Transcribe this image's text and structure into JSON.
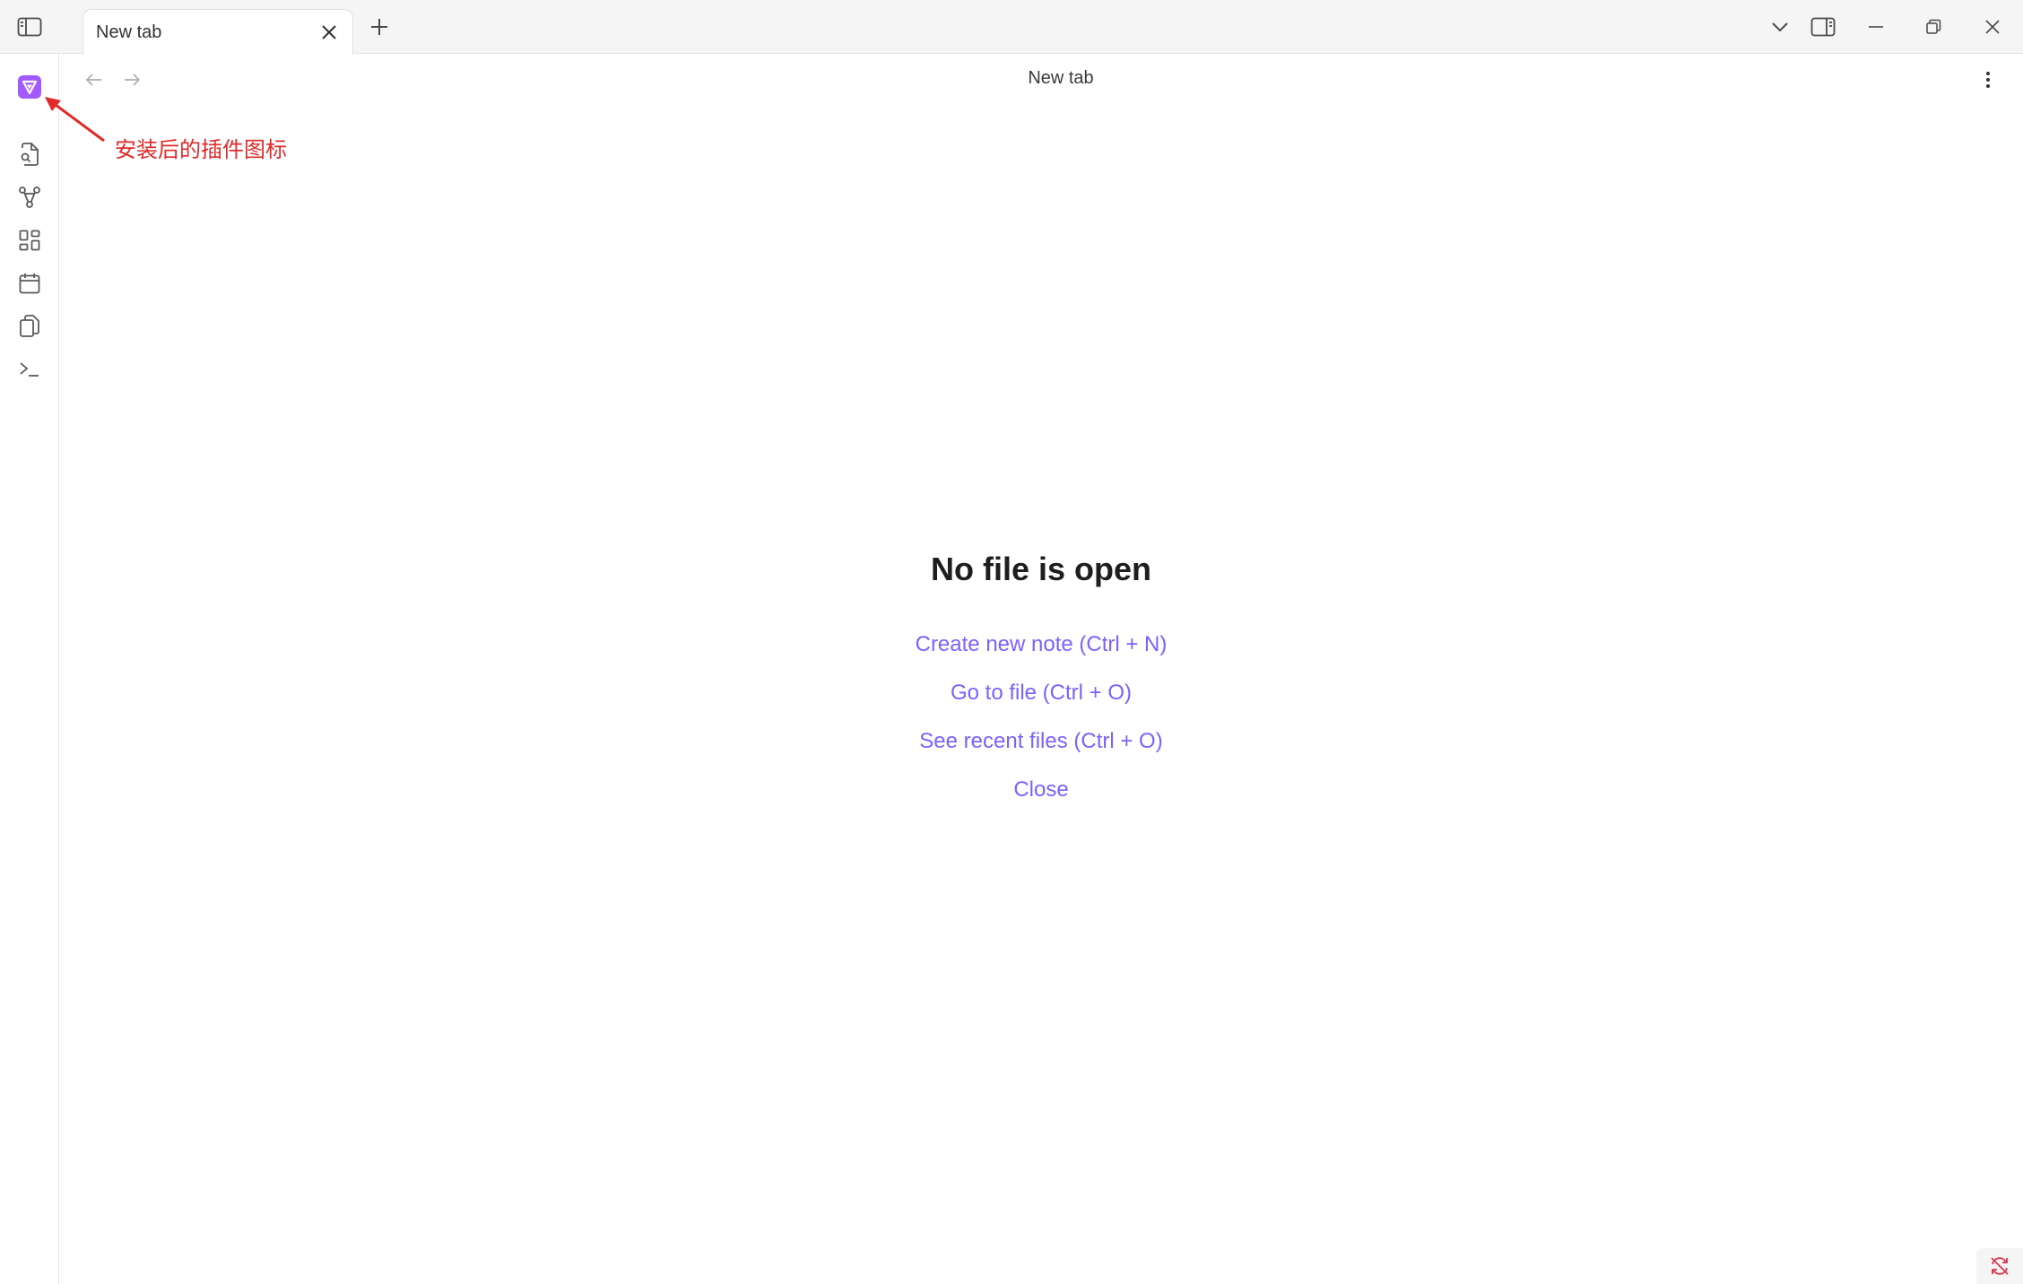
{
  "titlebar": {
    "tab_title": "New tab",
    "icons": {
      "sidebar_toggle": "sidebar-left-icon",
      "tab_close": "close-icon",
      "new_tab": "plus-icon",
      "tab_list": "chevron-down-icon",
      "right_sidebar": "sidebar-right-icon",
      "minimize": "minimize-icon",
      "restore": "restore-icon",
      "close_window": "close-icon"
    }
  },
  "ribbon": {
    "items": [
      {
        "name": "plugin-icon",
        "accent": "#a259ff"
      },
      {
        "name": "file-search-icon"
      },
      {
        "name": "graph-icon"
      },
      {
        "name": "canvas-grid-icon"
      },
      {
        "name": "calendar-icon"
      },
      {
        "name": "copy-files-icon"
      },
      {
        "name": "terminal-icon"
      }
    ]
  },
  "header": {
    "view_title": "New tab"
  },
  "annotation": {
    "text": "安装后的插件图标",
    "color": "#e02a2a"
  },
  "empty_state": {
    "title": "No file is open",
    "actions": [
      "Create new note (Ctrl + N)",
      "Go to file (Ctrl + O)",
      "See recent files (Ctrl + O)",
      "Close"
    ],
    "link_color": "#7b61ff"
  },
  "status": {
    "icon": "sync-off-icon",
    "color": "#e0314b"
  }
}
